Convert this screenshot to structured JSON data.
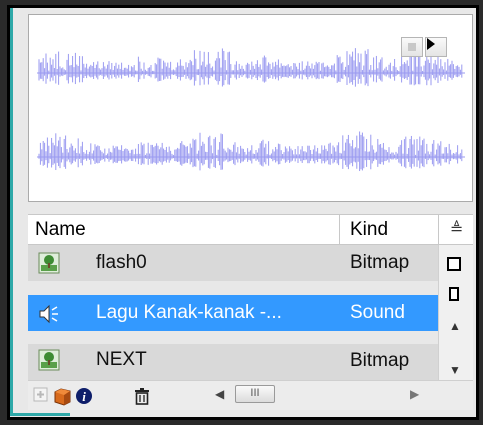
{
  "table": {
    "header": {
      "name": "Name",
      "kind": "Kind"
    },
    "rows": [
      {
        "name": "flash0",
        "kind": "Bitmap",
        "icon": "bitmap-icon"
      },
      {
        "name": "Lagu Kanak-kanak -...",
        "kind": "Sound",
        "icon": "sound-icon",
        "selected": true
      },
      {
        "name": "NEXT",
        "kind": "Bitmap",
        "icon": "bitmap-icon"
      }
    ]
  },
  "scrollbar": {
    "thumb_glyph": "III"
  },
  "colors": {
    "selection": "#3399ff",
    "waveform": "#9a9af0",
    "row_bg": "#d9d9d9",
    "accent_line": "#2ea8a8"
  }
}
